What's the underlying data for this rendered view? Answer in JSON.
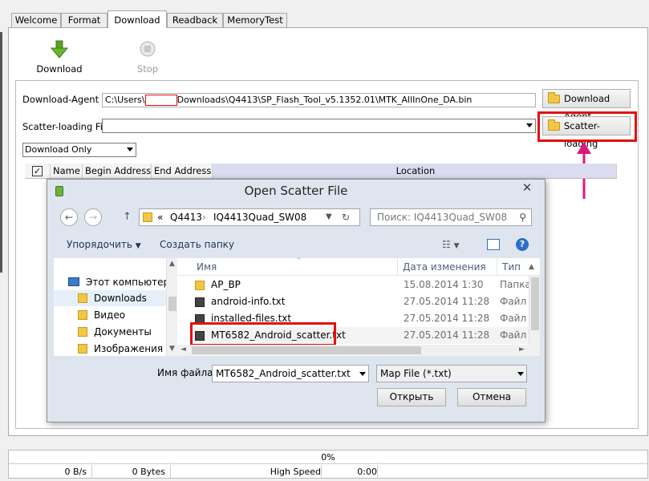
{
  "tabs": [
    "Welcome",
    "Format",
    "Download",
    "Readback",
    "MemoryTest"
  ],
  "toolbar": {
    "download_label": "Download",
    "stop_label": "Stop"
  },
  "form": {
    "download_agent_label": "Download-Agent",
    "download_agent_path_prefix": "C:\\Users\\",
    "download_agent_path_suffix": "Downloads\\Q4413\\SP_Flash_Tool_v5.1352.01\\MTK_AllInOne_DA.bin",
    "download_agent_button": "Download Agent",
    "scatter_label": "Scatter-loading File",
    "scatter_value": "",
    "scatter_button": "Scatter-loading",
    "mode_selected": "Download Only"
  },
  "table": {
    "columns": [
      "Name",
      "Begin Address",
      "End Address",
      "Location"
    ]
  },
  "dialog": {
    "title": "Open Scatter File",
    "close_glyph": "✕",
    "address_prefix": "«",
    "address_parts": [
      "Q4413",
      "IQ4413Quad_SW08"
    ],
    "search_placeholder": "Поиск: IQ4413Quad_SW08",
    "organize_label": "Упорядочить",
    "new_folder_label": "Создать папку",
    "nav_tree": [
      "Этот компьютер",
      "Downloads",
      "Видео",
      "Документы",
      "Изображения"
    ],
    "columns": {
      "name": "Имя",
      "date": "Дата изменения",
      "type": "Тип"
    },
    "files": [
      {
        "name": "AP_BP",
        "date": "15.08.2014 1:30",
        "type": "Папка",
        "kind": "folder"
      },
      {
        "name": "android-info.txt",
        "date": "27.05.2014 11:28",
        "type": "Файл",
        "kind": "file"
      },
      {
        "name": "installed-files.txt",
        "date": "27.05.2014 11:28",
        "type": "Файл",
        "kind": "file"
      },
      {
        "name": "MT6582_Android_scatter.txt",
        "date": "27.05.2014 11:28",
        "type": "Файл",
        "kind": "file"
      }
    ],
    "filename_label": "Имя файла:",
    "filename_value": "MT6582_Android_scatter.txt",
    "filter_value": "Map File (*.txt)",
    "open_button": "Открыть",
    "cancel_button": "Отмена"
  },
  "status": {
    "progress": "0%",
    "speed": "0 B/s",
    "bytes": "0 Bytes",
    "mode": "High Speed",
    "time": "0:00"
  },
  "colors": {
    "highlight": "#e31010",
    "annotation_arrow": "#e0177a",
    "download_arrow": "#5aa028"
  }
}
